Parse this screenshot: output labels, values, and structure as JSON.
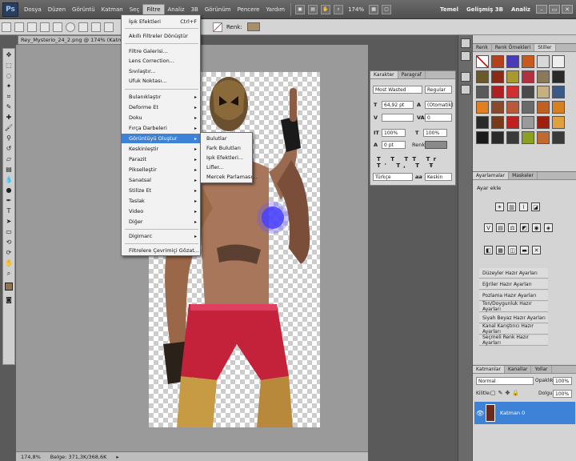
{
  "menubar": {
    "logo": "Ps",
    "items": [
      "Dosya",
      "Düzen",
      "Görüntü",
      "Katman",
      "Seç",
      "Filtre",
      "Analiz",
      "3B",
      "Görünüm",
      "Pencere",
      "Yardım"
    ],
    "active_item": "Filtre",
    "zoom": "174%",
    "workspaces": [
      "Temel",
      "Gelişmiş 3B",
      "Analiz"
    ],
    "window_buttons": [
      "–",
      "▭",
      "✕"
    ]
  },
  "options": {
    "mode_label": "Renk:"
  },
  "document": {
    "tab_title": "Rey_Mysterio_24_2.png @ 174% (Katman 0, RGB...",
    "status_zoom": "174,8%",
    "status_doc": "Belge: 371,3K/368,6K"
  },
  "filter_menu": {
    "last_filter": "İşık Efektleri",
    "last_filter_shortcut": "Ctrl+F",
    "items": [
      {
        "label": "Akıllı Filtreler Dönüştür",
        "arrow": ""
      },
      {
        "label": "Filtre Galerisi...",
        "arrow": ""
      },
      {
        "label": "Lens Correction...",
        "arrow": ""
      },
      {
        "label": "Sıvılaştır...",
        "arrow": ""
      },
      {
        "label": "Ufuk Noktası...",
        "arrow": ""
      },
      {
        "label": "Bulanıklaştır",
        "arrow": "▸"
      },
      {
        "label": "Deforme Et",
        "arrow": "▸"
      },
      {
        "label": "Doku",
        "arrow": "▸"
      },
      {
        "label": "Fırça Darbeleri",
        "arrow": "▸"
      },
      {
        "label": "Görüntüyü Oluştur",
        "arrow": "▸"
      },
      {
        "label": "Keskinleştir",
        "arrow": "▸"
      },
      {
        "label": "Parazit",
        "arrow": "▸"
      },
      {
        "label": "Pikselleştir",
        "arrow": "▸"
      },
      {
        "label": "Sanatsal",
        "arrow": "▸"
      },
      {
        "label": "Stilize Et",
        "arrow": "▸"
      },
      {
        "label": "Taslak",
        "arrow": "▸"
      },
      {
        "label": "Video",
        "arrow": "▸"
      },
      {
        "label": "Diğer",
        "arrow": "▸"
      },
      {
        "label": "Digimarc",
        "arrow": "▸"
      },
      {
        "label": "Filtrelere Çevrimiçi Gözat...",
        "arrow": ""
      }
    ]
  },
  "submenu": {
    "items": [
      "Bulutlar",
      "Fark Bulutları",
      "Işık Efektleri...",
      "Lifler...",
      "Mercek Parlaması..."
    ]
  },
  "character_panel": {
    "tabs": [
      "Karakter",
      "Paragraf"
    ],
    "font_family": "Most Wasted",
    "font_style": "Regular",
    "font_size": "64,92 pt",
    "leading": "(Otomatik)",
    "tracking": "0",
    "vscale": "100%",
    "hscale": "100%",
    "baseline": "0 pt",
    "color_label": "Renk:",
    "language": "Türkçe",
    "aa_icon": "aa",
    "aa": "Keskin"
  },
  "right_dock": {
    "top_tabs": [
      "Renk",
      "Renk Örnekleri",
      "Stiller"
    ],
    "adj_tabs": [
      "Ayarlamalar",
      "Maskeler"
    ],
    "adj_title": "Ayar ekle",
    "presets": [
      "Düzeyler Hazır Ayarları",
      "Eğriler Hazır Ayarları",
      "Pozlama Hazır Ayarları",
      "Ton/Doygunluk Hazır Ayarları",
      "Siyah Beyaz Hazır Ayarları",
      "Kanal Karıştırıcı Hazır Ayarları",
      "Seçmeli Renk Hazır Ayarları"
    ],
    "layer_tabs": [
      "Katmanlar",
      "Kanallar",
      "Yollar"
    ],
    "blend_mode": "Normal",
    "opacity_label": "Opaklık:",
    "opacity": "100%",
    "lock_label": "Kilitle:",
    "fill_label": "Dolgu:",
    "fill": "100%",
    "layer_name": "Katman 0"
  },
  "colors": {
    "accent": "#3d82d6",
    "foreground": "#8c7652"
  }
}
